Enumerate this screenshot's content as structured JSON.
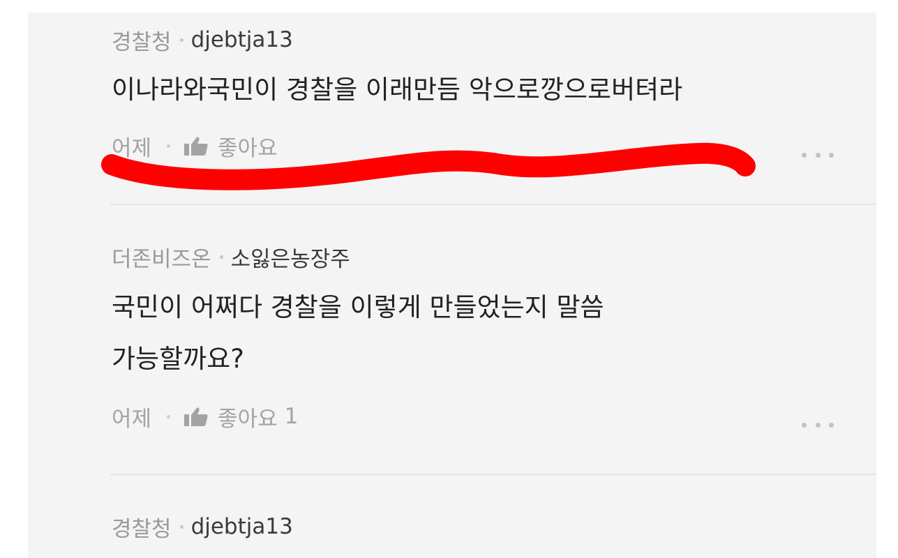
{
  "comments": [
    {
      "badge": "경찰청",
      "user": "djebtja13",
      "lines": [
        "이나라와국민이 경찰을 이래만듬 악으로깡으로버텨라"
      ],
      "time": "어제",
      "like_label": "좋아요",
      "like_count": ""
    },
    {
      "badge": "더존비즈온",
      "user": "소잃은농장주",
      "lines": [
        "국민이 어쩌다 경찰을 이렇게 만들었는지 말씀",
        "가능할까요?"
      ],
      "time": "어제",
      "like_label": "좋아요",
      "like_count": "1"
    },
    {
      "badge": "경찰청",
      "user": "djebtja13"
    }
  ],
  "icons": {
    "like": "thumbs-up-icon",
    "more": "more-options-icon"
  },
  "colors": {
    "panel_bg": "#f4f4f5",
    "highlight_stroke": "#ff0000"
  }
}
